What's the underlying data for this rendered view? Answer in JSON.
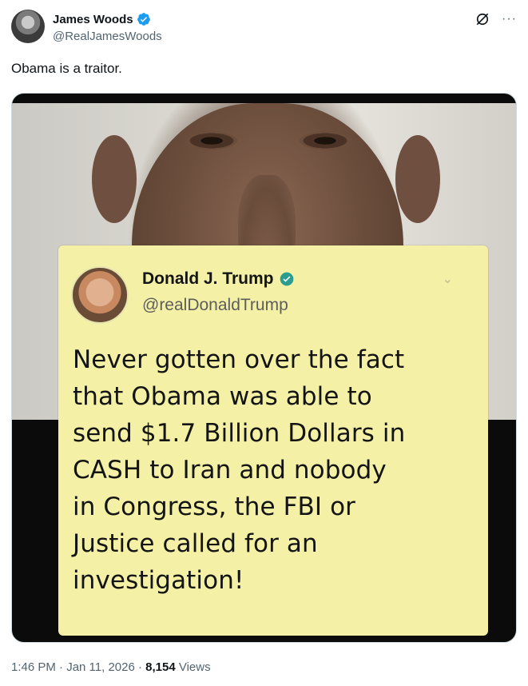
{
  "post": {
    "author": {
      "display_name": "James Woods",
      "handle": "@RealJamesWoods",
      "verified": true
    },
    "text": "Obama is a traitor.",
    "timestamp": "1:46 PM · Jan 11, 2026 · ",
    "views_count": "8,154",
    "views_label": " Views",
    "icons": [
      "grok-icon",
      "more-icon"
    ]
  },
  "embedded_tweet": {
    "display_name": "Donald J. Trump",
    "handle": "@realDonaldTrump",
    "verified": true,
    "lines": [
      "Never gotten over the fact",
      "that Obama was able to",
      "send $1.7 Billion Dollars in",
      "CASH to Iran and nobody",
      "in Congress, the FBI or",
      "Justice called for an",
      "investigation!"
    ]
  },
  "colors": {
    "verified_blue": "#1d9bf0",
    "card_bg": "#f4f1a6",
    "card_verified": "#2a9d8f",
    "muted_text": "#536471"
  }
}
